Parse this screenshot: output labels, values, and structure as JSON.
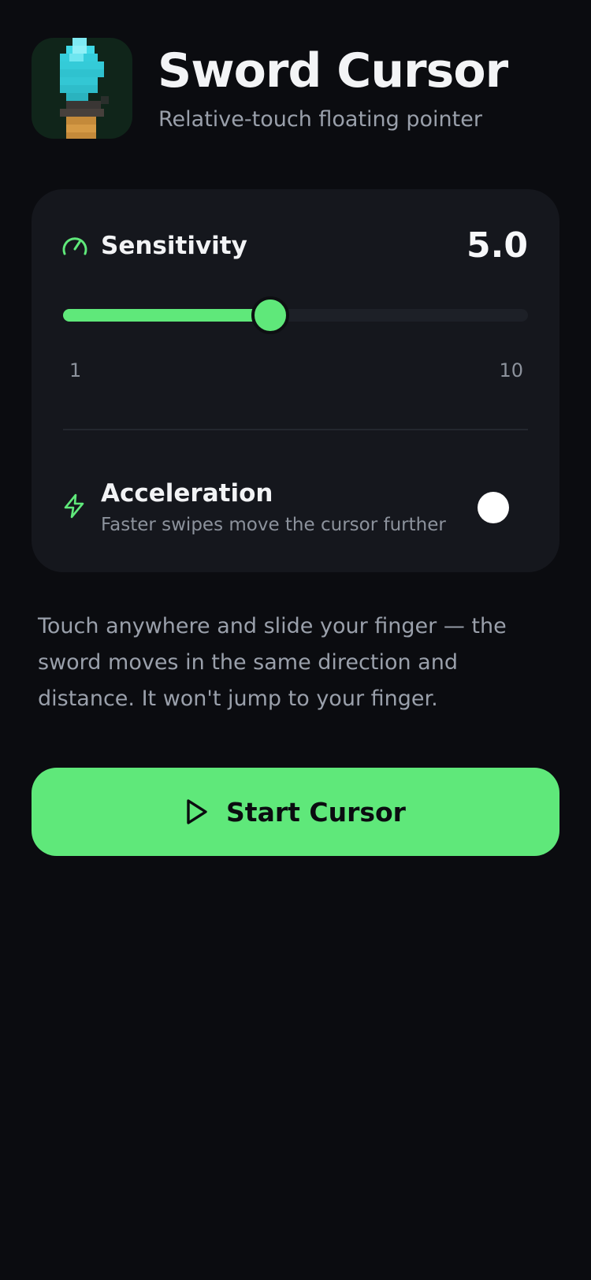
{
  "header": {
    "icon": "sword-app-icon",
    "title": "Sword Cursor",
    "subtitle": "Relative-touch floating pointer"
  },
  "settings": {
    "sensitivity": {
      "icon": "gauge-icon",
      "label": "Sensitivity",
      "value": "5.0",
      "min": "1",
      "max": "10",
      "fill_fraction": 0.445
    },
    "acceleration": {
      "icon": "lightning-icon",
      "label": "Acceleration",
      "description": "Faster swipes move the cursor further",
      "enabled": false
    }
  },
  "help_text": "Touch anywhere and slide your finger — the sword moves in the same direction and distance. It won't jump to your finger.",
  "start_button": {
    "icon": "play-icon",
    "label": "Start Cursor"
  },
  "colors": {
    "background": "#0b0c10",
    "card": "#15171d",
    "accent": "#5fe87a",
    "text_primary": "#f2f3f5",
    "text_secondary": "#9aa0ab"
  }
}
